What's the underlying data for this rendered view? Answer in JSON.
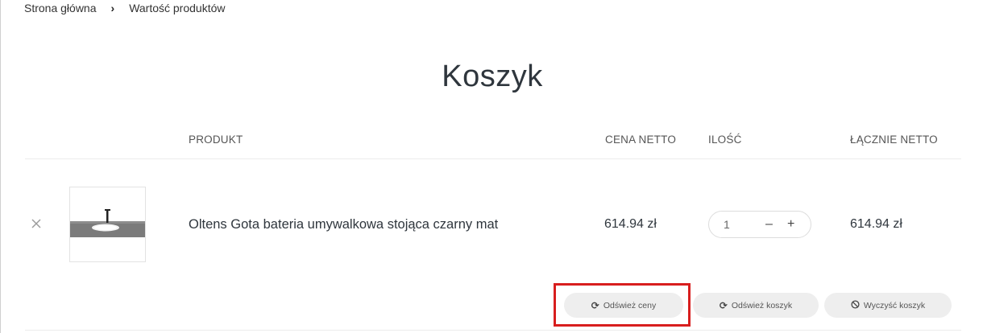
{
  "breadcrumb": {
    "home": "Strona główna",
    "separator": "›",
    "current": "Wartość produktów"
  },
  "page": {
    "title": "Koszyk"
  },
  "table": {
    "headers": {
      "product": "PRODUKT",
      "price": "CENA NETTO",
      "quantity": "ILOŚĆ",
      "total": "ŁĄCZNIE NETTO"
    }
  },
  "items": [
    {
      "remove_icon": "close-icon",
      "name": "Oltens Gota bateria umywalkowa stojąca czarny mat",
      "price": "614.94 zł",
      "quantity": "1",
      "decrement": "–",
      "increment": "+",
      "total": "614.94 zł"
    }
  ],
  "actions": {
    "refresh_prices": {
      "label": "Odśwież ceny",
      "icon": "refresh-icon"
    },
    "refresh_cart": {
      "label": "Odśwież koszyk",
      "icon": "refresh-icon"
    },
    "clear_cart": {
      "label": "Wyczyść koszyk",
      "icon": "ban-icon"
    }
  },
  "colors": {
    "highlight": "#d81e1e",
    "button_bg": "#eeeeee"
  }
}
